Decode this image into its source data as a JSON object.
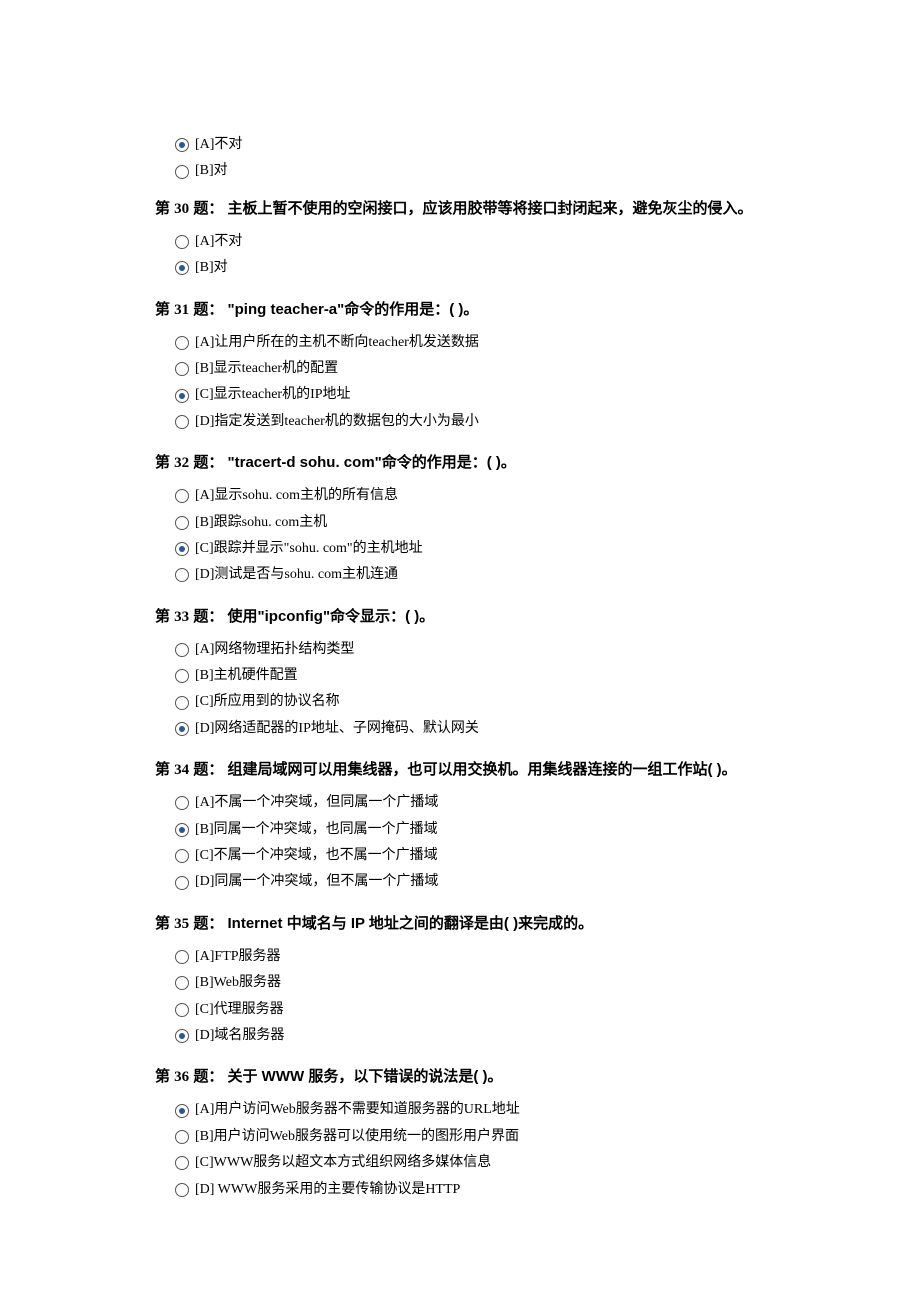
{
  "orphan": {
    "options": [
      {
        "text": "[A]不对",
        "selected": true
      },
      {
        "text": "[B]对",
        "selected": false
      }
    ]
  },
  "questions": [
    {
      "num": "30",
      "title": "主板上暂不使用的空闲接口，应该用胶带等将接口封闭起来，避免灰尘的侵入。",
      "options": [
        {
          "text": "[A]不对",
          "selected": false
        },
        {
          "text": "[B]对",
          "selected": true
        }
      ]
    },
    {
      "num": "31",
      "title": "\"ping teacher-a\"命令的作用是：(     )。",
      "options": [
        {
          "text": "[A]让用户所在的主机不断向teacher机发送数据",
          "selected": false
        },
        {
          "text": "[B]显示teacher机的配置",
          "selected": false
        },
        {
          "text": "[C]显示teacher机的IP地址",
          "selected": true
        },
        {
          "text": "[D]指定发送到teacher机的数据包的大小为最小",
          "selected": false
        }
      ]
    },
    {
      "num": "32",
      "title": "\"tracert-d sohu. com\"命令的作用是：(     )。",
      "options": [
        {
          "text": "[A]显示sohu. com主机的所有信息",
          "selected": false
        },
        {
          "text": "[B]跟踪sohu. com主机",
          "selected": false
        },
        {
          "text": "[C]跟踪并显示\"sohu. com\"的主机地址",
          "selected": true
        },
        {
          "text": "[D]测试是否与sohu. com主机连通",
          "selected": false
        }
      ]
    },
    {
      "num": "33",
      "title": "使用\"ipconfig\"命令显示：(    )。",
      "options": [
        {
          "text": "[A]网络物理拓扑结构类型",
          "selected": false
        },
        {
          "text": "[B]主机硬件配置",
          "selected": false
        },
        {
          "text": "[C]所应用到的协议名称",
          "selected": false
        },
        {
          "text": "[D]网络适配器的IP地址、子网掩码、默认网关",
          "selected": true
        }
      ]
    },
    {
      "num": "34",
      "title": "组建局域网可以用集线器，也可以用交换机。用集线器连接的一组工作站(    )。",
      "options": [
        {
          "text": "[A]不属一个冲突域，但同属一个广播域",
          "selected": false
        },
        {
          "text": "[B]同属一个冲突域，也同属一个广播域",
          "selected": true
        },
        {
          "text": "[C]不属一个冲突域，也不属一个广播域",
          "selected": false
        },
        {
          "text": "[D]同属一个冲突域，但不属一个广播域",
          "selected": false
        }
      ]
    },
    {
      "num": "35",
      "title": "Internet 中域名与 IP 地址之间的翻译是由(    )来完成的。",
      "options": [
        {
          "text": "[A]FTP服务器",
          "selected": false
        },
        {
          "text": "[B]Web服务器",
          "selected": false
        },
        {
          "text": "[C]代理服务器",
          "selected": false
        },
        {
          "text": "[D]域名服务器",
          "selected": true
        }
      ]
    },
    {
      "num": "36",
      "title": "关于 WWW 服务，以下错误的说法是(    )。",
      "options": [
        {
          "text": "[A]用户访问Web服务器不需要知道服务器的URL地址",
          "selected": true
        },
        {
          "text": "[B]用户访问Web服务器可以使用统一的图形用户界面",
          "selected": false
        },
        {
          "text": "[C]WWW服务以超文本方式组织网络多媒体信息",
          "selected": false
        },
        {
          "text": "[D] WWW服务采用的主要传输协议是HTTP",
          "selected": false
        }
      ]
    }
  ],
  "labels": {
    "prefix": "第 ",
    "suffix": " 题：  "
  }
}
